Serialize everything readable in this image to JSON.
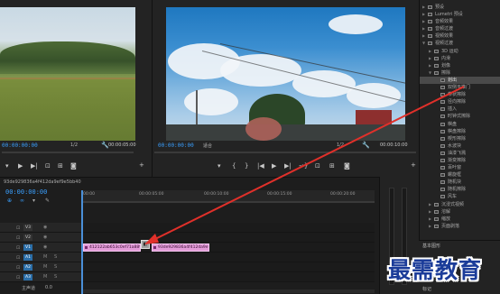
{
  "source_monitor": {
    "zoom": "1/2",
    "timecode_in": "00:00:00:00",
    "timecode_out": "00:00:05:00"
  },
  "program_monitor": {
    "timecode": "00:00:00:00",
    "fit": "适合",
    "zoom": "1/2",
    "duration": "00:00:10:00"
  },
  "effects_panel": {
    "items": [
      {
        "label": "预设",
        "depth": 0,
        "kind": "folder"
      },
      {
        "label": "Lumetri 预设",
        "depth": 0,
        "kind": "folder"
      },
      {
        "label": "音频效果",
        "depth": 0,
        "kind": "folder"
      },
      {
        "label": "音频过渡",
        "depth": 0,
        "kind": "folder"
      },
      {
        "label": "视频效果",
        "depth": 0,
        "kind": "folder"
      },
      {
        "label": "视频过渡",
        "depth": 0,
        "kind": "folder",
        "open": true
      },
      {
        "label": "3D 运动",
        "depth": 1,
        "kind": "folder"
      },
      {
        "label": "内滑",
        "depth": 1,
        "kind": "folder"
      },
      {
        "label": "划像",
        "depth": 1,
        "kind": "folder"
      },
      {
        "label": "擦除",
        "depth": 1,
        "kind": "folder",
        "open": true
      },
      {
        "label": "划出",
        "depth": 2,
        "kind": "effect",
        "selected": true
      },
      {
        "label": "双侧平推门",
        "depth": 2,
        "kind": "effect"
      },
      {
        "label": "带状擦除",
        "depth": 2,
        "kind": "effect"
      },
      {
        "label": "径向擦除",
        "depth": 2,
        "kind": "effect"
      },
      {
        "label": "插入",
        "depth": 2,
        "kind": "effect"
      },
      {
        "label": "时钟式擦除",
        "depth": 2,
        "kind": "effect"
      },
      {
        "label": "棋盘",
        "depth": 2,
        "kind": "effect"
      },
      {
        "label": "棋盘擦除",
        "depth": 2,
        "kind": "effect"
      },
      {
        "label": "楔形擦除",
        "depth": 2,
        "kind": "effect"
      },
      {
        "label": "水波块",
        "depth": 2,
        "kind": "effect"
      },
      {
        "label": "油漆飞溅",
        "depth": 2,
        "kind": "effect"
      },
      {
        "label": "渐变擦除",
        "depth": 2,
        "kind": "effect"
      },
      {
        "label": "百叶窗",
        "depth": 2,
        "kind": "effect"
      },
      {
        "label": "螺旋框",
        "depth": 2,
        "kind": "effect"
      },
      {
        "label": "随机块",
        "depth": 2,
        "kind": "effect"
      },
      {
        "label": "随机擦除",
        "depth": 2,
        "kind": "effect"
      },
      {
        "label": "风车",
        "depth": 2,
        "kind": "effect"
      },
      {
        "label": "沉浸式视频",
        "depth": 1,
        "kind": "folder"
      },
      {
        "label": "溶解",
        "depth": 1,
        "kind": "folder"
      },
      {
        "label": "缩放",
        "depth": 1,
        "kind": "folder"
      },
      {
        "label": "页面剥落",
        "depth": 1,
        "kind": "folder"
      }
    ],
    "sub_panel_title": "基本图形",
    "sub_panel_label": "标记"
  },
  "timeline": {
    "tab": "93de929836a4f412da9ef9e5bb40",
    "timecode": "00:00:00:00",
    "ruler": [
      "00:00",
      "00:00:05:00",
      "00:00:10:00",
      "00:00:15:00",
      "00:00:20:00"
    ],
    "tracks": [
      {
        "name": "V3",
        "active": false
      },
      {
        "name": "V2",
        "active": false
      },
      {
        "name": "V1",
        "active": true
      },
      {
        "name": "A1",
        "active": true
      },
      {
        "name": "A2",
        "active": true
      },
      {
        "name": "A3",
        "active": true
      }
    ],
    "clips": [
      {
        "label": "412122ab653c0ef71a889e3e276"
      },
      {
        "label": "93de929836a4f412da9ef9e5bb40"
      }
    ],
    "master": "主声道",
    "master_value": "0.0"
  },
  "watermark": "最需教育",
  "colors": {
    "accent": "#3aa0ff",
    "clip": "#e39ad8",
    "arrow": "#e0302a",
    "watermark": "#1b3c99"
  }
}
